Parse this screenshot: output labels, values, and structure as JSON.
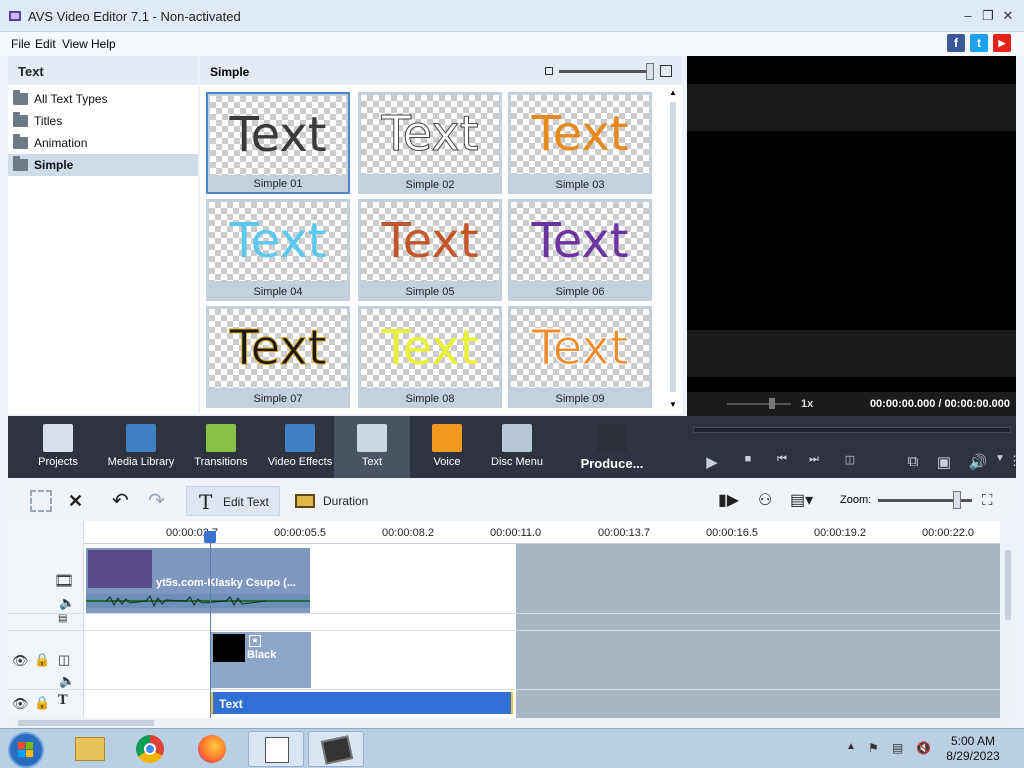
{
  "window": {
    "title": "AVS Video Editor 7.1 - Non-activated"
  },
  "menu": [
    "File",
    "Edit",
    "View",
    "Help"
  ],
  "social": [
    "f",
    "t",
    "▶"
  ],
  "left_panel": {
    "header": "Text",
    "items": [
      "All Text Types",
      "Titles",
      "Animation",
      "Simple"
    ],
    "selected": "Simple"
  },
  "center_panel": {
    "header": "Simple",
    "sample_text": "Text",
    "tiles": [
      {
        "caption": "Simple 01",
        "color": "#3a3a3a"
      },
      {
        "caption": "Simple 02",
        "color": "#ffffff"
      },
      {
        "caption": "Simple 03",
        "color": "#e58a1f"
      },
      {
        "caption": "Simple 04",
        "color": "#5bc8f0"
      },
      {
        "caption": "Simple 05",
        "color": "#c2572b"
      },
      {
        "caption": "Simple 06",
        "color": "#6a35a0"
      },
      {
        "caption": "Simple 07",
        "color": "#1a1a1a"
      },
      {
        "caption": "Simple 08",
        "color": "#e8f03a"
      },
      {
        "caption": "Simple 09",
        "color": "#f08a2b"
      }
    ]
  },
  "preview": {
    "speed": "1x",
    "timecode": "00:00:00.000  /  00:00:00.000"
  },
  "toolbar": {
    "tools": [
      {
        "label": "Projects",
        "icon": "clapboard-icon",
        "color": "#d9dfe8"
      },
      {
        "label": "Media Library",
        "icon": "film-icon",
        "color": "#3f7fc4"
      },
      {
        "label": "Transitions",
        "icon": "transitions-icon",
        "color": "#8bc34a"
      },
      {
        "label": "Video Effects",
        "icon": "video-effects-icon",
        "color": "#3f7fc4"
      },
      {
        "label": "Text",
        "icon": "text-icon",
        "color": "#c9d6e6"
      },
      {
        "label": "Voice",
        "icon": "microphone-icon",
        "color": "#f29a1f"
      },
      {
        "label": "Disc Menu",
        "icon": "disc-icon",
        "color": "#b7c7da"
      },
      {
        "label": "Produce...",
        "icon": "produce-icon",
        "color": "#2b2f38"
      }
    ]
  },
  "timeline_toolbar": {
    "edit_text": "Edit Text",
    "duration": "Duration",
    "zoom_label": "Zoom:"
  },
  "ruler": [
    "00:00:02.7",
    "00:00:05.5",
    "00:00:08.2",
    "00:00:11.0",
    "00:00:13.7",
    "00:00:16.5",
    "00:00:19.2",
    "00:00:22.0"
  ],
  "clips": {
    "video_label": "yt5s.com-Klasky Csupo (...",
    "overlay_label": "Black",
    "text_label": "Text"
  },
  "taskbar": {
    "time": "5:00 AM",
    "date": "8/29/2023"
  }
}
